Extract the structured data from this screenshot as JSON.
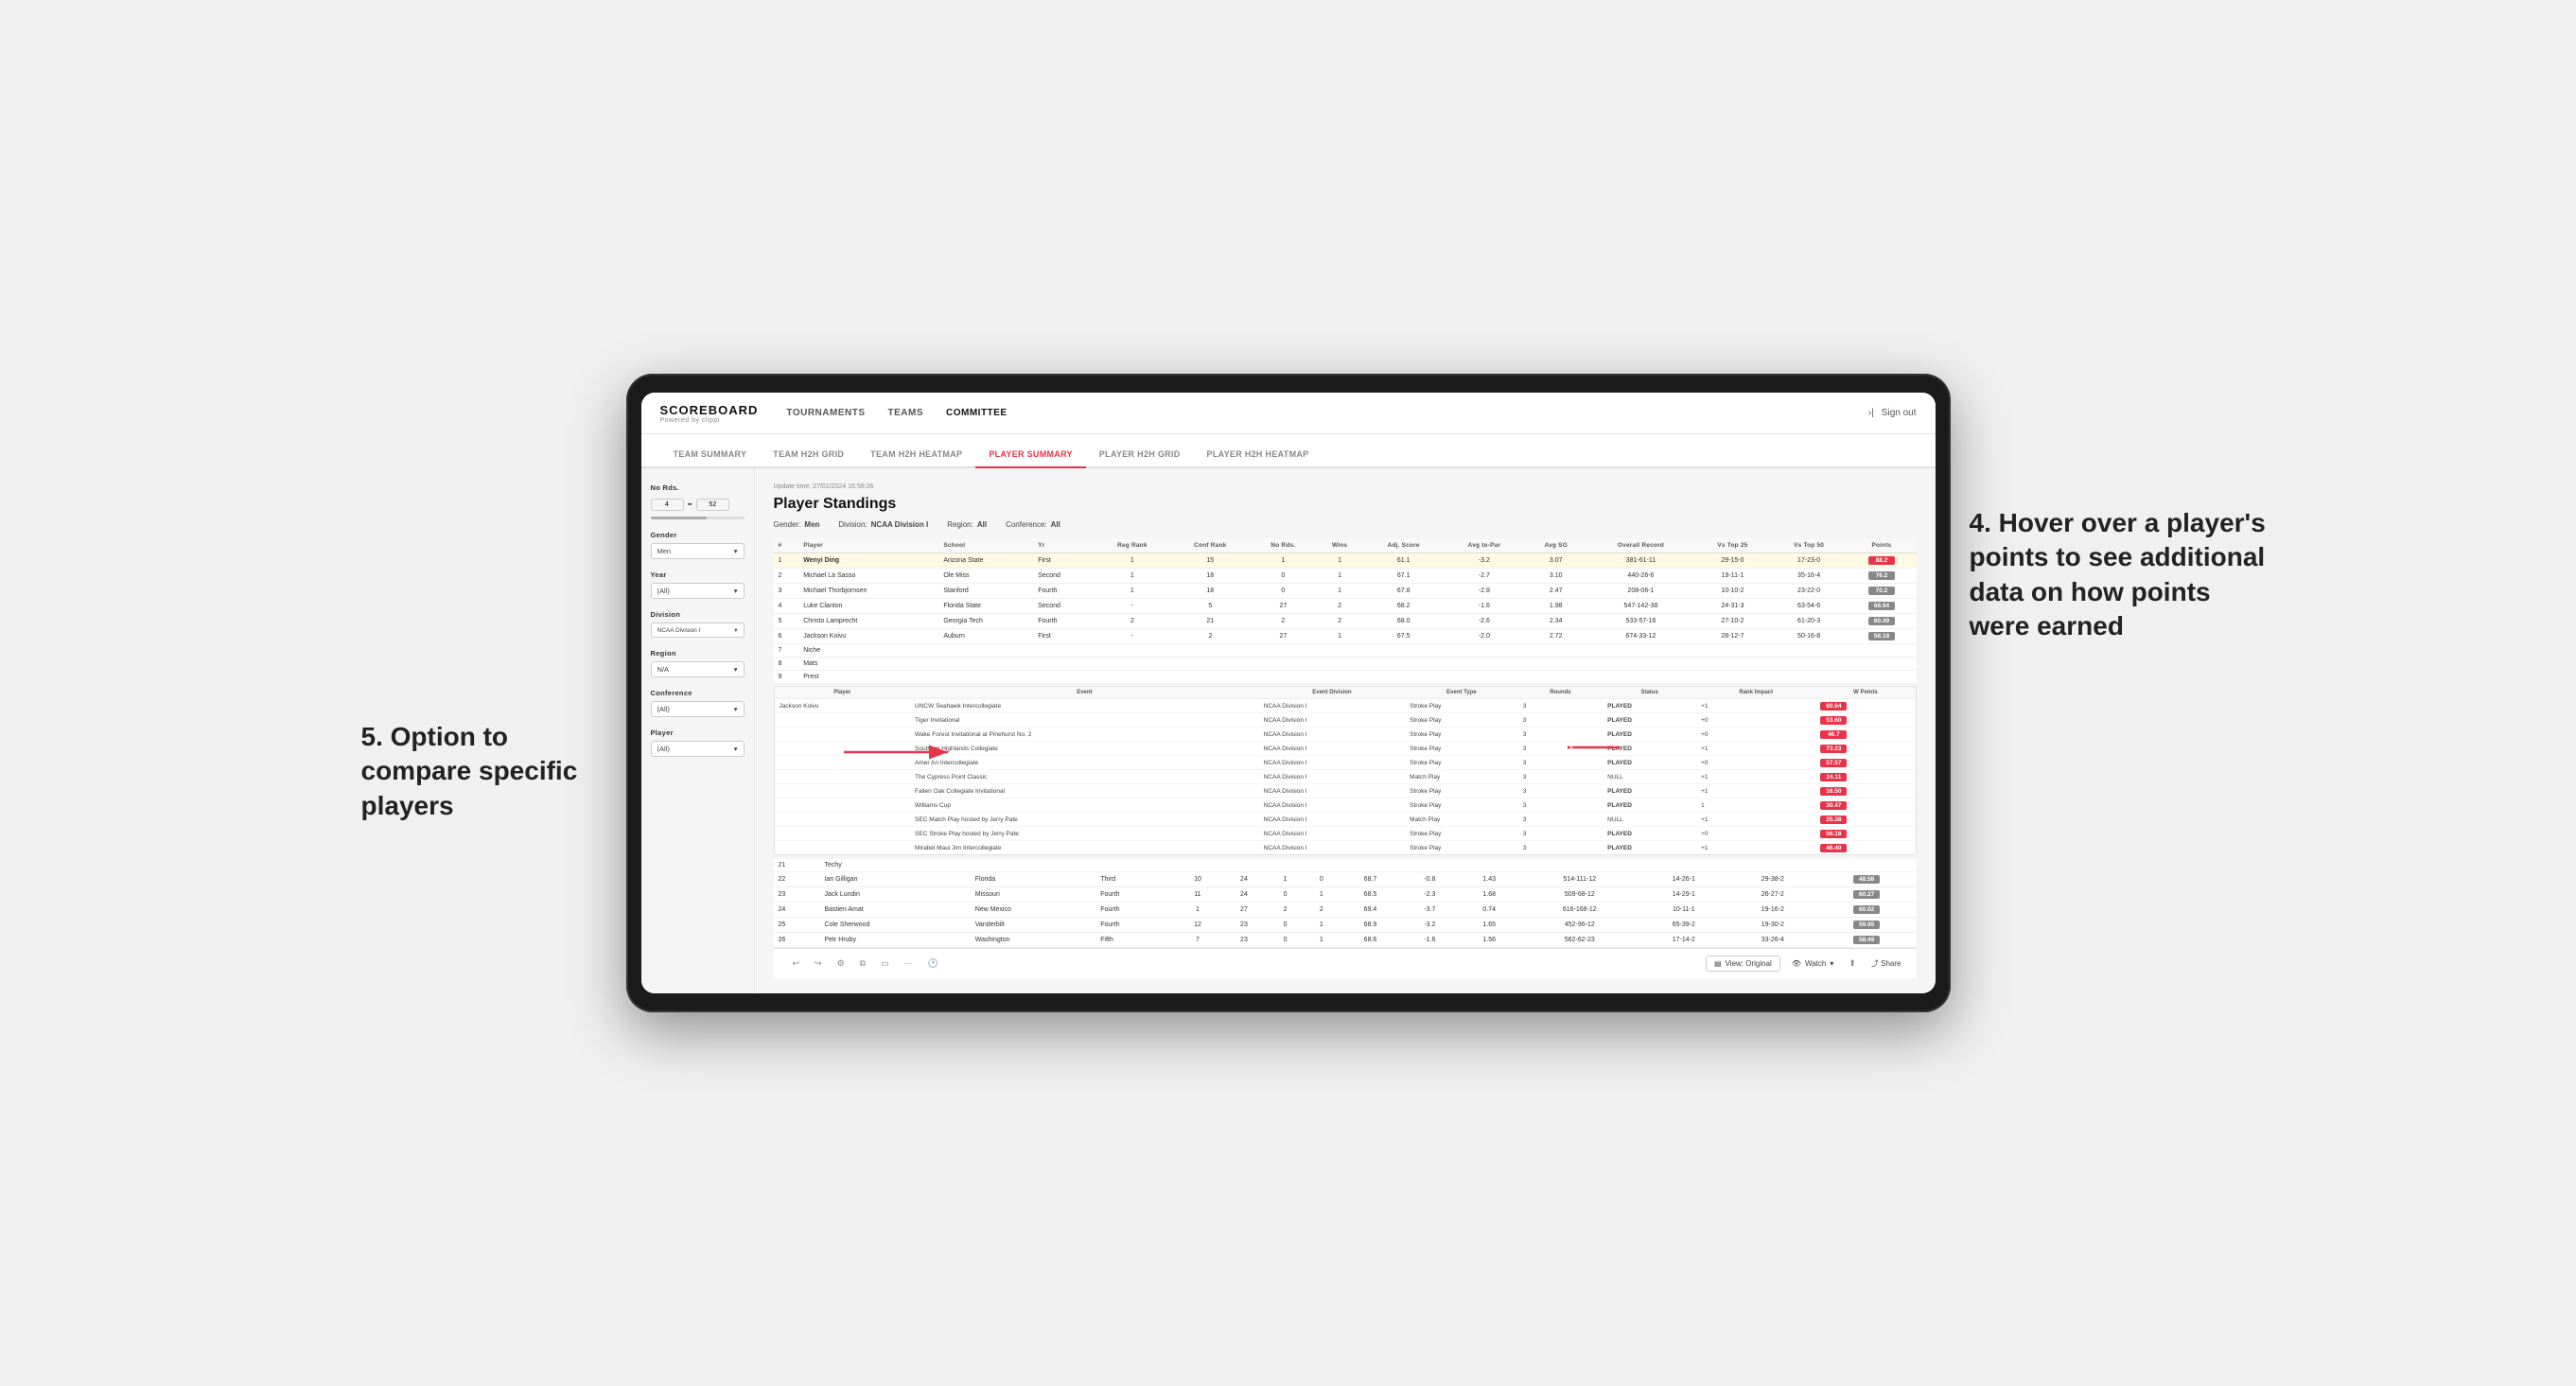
{
  "page": {
    "title": "Scoreboard",
    "logo": "SCOREBOARD",
    "logo_sub": "Powered by clippi"
  },
  "header": {
    "nav_items": [
      "TOURNAMENTS",
      "TEAMS",
      "COMMITTEE"
    ],
    "sign_out": "Sign out"
  },
  "sub_nav": {
    "items": [
      "TEAM SUMMARY",
      "TEAM H2H GRID",
      "TEAM H2H HEATMAP",
      "PLAYER SUMMARY",
      "PLAYER H2H GRID",
      "PLAYER H2H HEATMAP"
    ],
    "active": "PLAYER SUMMARY"
  },
  "sidebar": {
    "no_rds_label": "No Rds.",
    "no_rds_min": "4",
    "no_rds_max": "52",
    "gender_label": "Gender",
    "gender_value": "Men",
    "year_label": "Year",
    "year_value": "(All)",
    "division_label": "Division",
    "division_value": "NCAA Division I",
    "region_label": "Region",
    "region_value": "N/A",
    "conference_label": "Conference",
    "conference_value": "(All)",
    "player_label": "Player",
    "player_value": "(All)"
  },
  "content": {
    "update_time": "Update time: 27/01/2024 16:56:26",
    "title": "Player Standings",
    "filters": {
      "gender": "Men",
      "division": "NCAA Division I",
      "region": "All",
      "conference": "All"
    },
    "table_headers": [
      "#",
      "Player",
      "School",
      "Yr",
      "Reg Rank",
      "Conf Rank",
      "No Rds.",
      "Wins",
      "Adj. Score",
      "Avg to-Par",
      "Avg SG",
      "Overall Record",
      "Vs Top 25",
      "Vs Top 50",
      "Points"
    ],
    "rows": [
      {
        "rank": "1",
        "player": "Wenyi Ding",
        "school": "Arizona State",
        "yr": "First",
        "reg_rank": "1",
        "conf_rank": "15",
        "no_rds": "1",
        "wins": "1",
        "adj_score": "61.1",
        "avg_par": "-3.2",
        "avg_sg": "3.07",
        "overall": "381-61-11",
        "top25": "29-15-0",
        "top50": "17-23-0",
        "points": "88.2",
        "highlight": true
      },
      {
        "rank": "2",
        "player": "Michael La Sasso",
        "school": "Ole Miss",
        "yr": "Second",
        "reg_rank": "1",
        "conf_rank": "18",
        "no_rds": "0",
        "wins": "1",
        "adj_score": "67.1",
        "avg_par": "-2.7",
        "avg_sg": "3.10",
        "overall": "440-26-6",
        "top25": "19-11-1",
        "top50": "35-16-4",
        "points": "76.2",
        "highlight": false
      },
      {
        "rank": "3",
        "player": "Michael Thorbjornsen",
        "school": "Stanford",
        "yr": "Fourth",
        "reg_rank": "1",
        "conf_rank": "18",
        "no_rds": "0",
        "wins": "1",
        "adj_score": "67.8",
        "avg_par": "-2.8",
        "avg_sg": "2.47",
        "overall": "208-06-1",
        "top25": "10-10-2",
        "top50": "23-22-0",
        "points": "70.2",
        "highlight": false
      },
      {
        "rank": "4",
        "player": "Luke Clanton",
        "school": "Florida State",
        "yr": "Second",
        "reg_rank": "-",
        "conf_rank": "5",
        "no_rds": "27",
        "wins": "2",
        "adj_score": "68.2",
        "avg_par": "-1.6",
        "avg_sg": "1.98",
        "overall": "547-142-38",
        "top25": "24-31-3",
        "top50": "63-54-6",
        "points": "68.94",
        "highlight": false
      },
      {
        "rank": "5",
        "player": "Christo Lamprecht",
        "school": "Georgia Tech",
        "yr": "Fourth",
        "reg_rank": "2",
        "conf_rank": "21",
        "no_rds": "2",
        "wins": "2",
        "adj_score": "68.0",
        "avg_par": "-2.6",
        "avg_sg": "2.34",
        "overall": "533-57-16",
        "top25": "27-10-2",
        "top50": "61-20-3",
        "points": "60.49",
        "highlight": false
      },
      {
        "rank": "6",
        "player": "Jackson Koivu",
        "school": "Auburn",
        "yr": "First",
        "reg_rank": "-",
        "conf_rank": "2",
        "no_rds": "27",
        "wins": "1",
        "adj_score": "67.5",
        "avg_par": "-2.0",
        "avg_sg": "2.72",
        "overall": "674-33-12",
        "top25": "28-12-7",
        "top50": "50-16-8",
        "points": "58.18",
        "highlight": false
      },
      {
        "rank": "7",
        "player": "Niche",
        "school": "",
        "yr": "",
        "reg_rank": "",
        "conf_rank": "",
        "no_rds": "",
        "wins": "",
        "adj_score": "",
        "avg_par": "",
        "avg_sg": "",
        "overall": "",
        "top25": "",
        "top50": "",
        "points": "",
        "highlight": false
      },
      {
        "rank": "8",
        "player": "Mats",
        "school": "",
        "yr": "",
        "reg_rank": "",
        "conf_rank": "",
        "no_rds": "",
        "wins": "",
        "adj_score": "",
        "avg_par": "",
        "avg_sg": "",
        "overall": "",
        "top25": "",
        "top50": "",
        "points": "",
        "highlight": false
      },
      {
        "rank": "9",
        "player": "Prest",
        "school": "",
        "yr": "",
        "reg_rank": "",
        "conf_rank": "",
        "no_rds": "",
        "wins": "",
        "adj_score": "",
        "avg_par": "",
        "avg_sg": "",
        "overall": "",
        "top25": "",
        "top50": "",
        "points": "",
        "highlight": false
      }
    ],
    "expanded_player": "Jackson Koivu",
    "expanded_rows": [
      {
        "event": "UNCW Seahawk Intercollegiate",
        "division": "NCAA Division I",
        "type": "Stroke Play",
        "rounds": "3",
        "status": "PLAYED",
        "rank_impact": "+1",
        "w_points": "60.64"
      },
      {
        "event": "Tiger Invitational",
        "division": "NCAA Division I",
        "type": "Stroke Play",
        "rounds": "3",
        "status": "PLAYED",
        "rank_impact": "+0",
        "w_points": "53.60"
      },
      {
        "event": "Wake Forest Invitational at Pinehurst No. 2",
        "division": "NCAA Division I",
        "type": "Stroke Play",
        "rounds": "3",
        "status": "PLAYED",
        "rank_impact": "+0",
        "w_points": "46.7"
      },
      {
        "event": "Southern Highlands Collegiate",
        "division": "NCAA Division I",
        "type": "Stroke Play",
        "rounds": "3",
        "status": "PLAYED",
        "rank_impact": "+1",
        "w_points": "73.23"
      },
      {
        "event": "Amer An Intercollegiate",
        "division": "NCAA Division I",
        "type": "Stroke Play",
        "rounds": "3",
        "status": "PLAYED",
        "rank_impact": "+0",
        "w_points": "57.57"
      },
      {
        "event": "The Cypress Point Classic",
        "division": "NCAA Division I",
        "type": "Match Play",
        "rounds": "3",
        "status": "NULL",
        "rank_impact": "+1",
        "w_points": "24.11"
      },
      {
        "event": "Fallen Oak Collegiate Invitational",
        "division": "NCAA Division I",
        "type": "Stroke Play",
        "rounds": "3",
        "status": "PLAYED",
        "rank_impact": "+1",
        "w_points": "16.50"
      },
      {
        "event": "Williams Cup",
        "division": "NCAA Division I",
        "type": "Stroke Play",
        "rounds": "3",
        "status": "PLAYED",
        "rank_impact": "1",
        "w_points": "30.47"
      },
      {
        "event": "SEC Match Play hosted by Jerry Pate",
        "division": "NCAA Division I",
        "type": "Match Play",
        "rounds": "3",
        "status": "NULL",
        "rank_impact": "+1",
        "w_points": "25.38"
      },
      {
        "event": "SEC Stroke Play hosted by Jerry Pate",
        "division": "NCAA Division I",
        "type": "Stroke Play",
        "rounds": "3",
        "status": "PLAYED",
        "rank_impact": "+0",
        "w_points": "56.18"
      },
      {
        "event": "Mirabel Maui Jim Intercollegiate",
        "division": "NCAA Division I",
        "type": "Stroke Play",
        "rounds": "3",
        "status": "PLAYED",
        "rank_impact": "+1",
        "w_points": "46.40"
      }
    ],
    "lower_rows": [
      {
        "rank": "21",
        "player": "Techy",
        "school": "",
        "yr": "",
        "reg_rank": "",
        "conf_rank": "",
        "no_rds": "",
        "wins": "",
        "adj_score": "",
        "avg_par": "",
        "avg_sg": "",
        "overall": "",
        "top25": "",
        "top50": "",
        "points": ""
      },
      {
        "rank": "22",
        "player": "Ian Gilligan",
        "school": "Florida",
        "yr": "Third",
        "reg_rank": "10",
        "conf_rank": "24",
        "no_rds": "1",
        "wins": "0",
        "adj_score": "68.7",
        "avg_par": "-0.8",
        "avg_sg": "1.43",
        "overall": "514-111-12",
        "top25": "14-26-1",
        "top50": "29-38-2",
        "points": "48.58"
      },
      {
        "rank": "23",
        "player": "Jack Lundin",
        "school": "Missouri",
        "yr": "Fourth",
        "reg_rank": "11",
        "conf_rank": "24",
        "no_rds": "0",
        "wins": "1",
        "adj_score": "68.5",
        "avg_par": "-2.3",
        "avg_sg": "1.68",
        "overall": "509-68-12",
        "top25": "14-29-1",
        "top50": "26-27-2",
        "points": "60.27"
      },
      {
        "rank": "24",
        "player": "Bastien Amat",
        "school": "New Mexico",
        "yr": "Fourth",
        "reg_rank": "1",
        "conf_rank": "27",
        "no_rds": "2",
        "wins": "2",
        "adj_score": "69.4",
        "avg_par": "-3.7",
        "avg_sg": "0.74",
        "overall": "616-168-12",
        "top25": "10-11-1",
        "top50": "19-16-2",
        "points": "60.02"
      },
      {
        "rank": "25",
        "player": "Cole Sherwood",
        "school": "Vanderbilt",
        "yr": "Fourth",
        "reg_rank": "12",
        "conf_rank": "23",
        "no_rds": "0",
        "wins": "1",
        "adj_score": "68.9",
        "avg_par": "-3.2",
        "avg_sg": "1.65",
        "overall": "452-96-12",
        "top25": "65-39-2",
        "top50": "19-30-2",
        "points": "59.95"
      },
      {
        "rank": "26",
        "player": "Petr Hruby",
        "school": "Washington",
        "yr": "Fifth",
        "reg_rank": "7",
        "conf_rank": "23",
        "no_rds": "0",
        "wins": "1",
        "adj_score": "68.6",
        "avg_par": "-1.6",
        "avg_sg": "1.56",
        "overall": "562-62-23",
        "top25": "17-14-2",
        "top50": "33-26-4",
        "points": "58.49"
      }
    ]
  },
  "toolbar": {
    "view_label": "View: Original",
    "watch_label": "Watch",
    "share_label": "Share"
  },
  "annotations": {
    "right": "4. Hover over a player's points to see additional data on how points were earned",
    "left": "5. Option to compare specific players"
  }
}
